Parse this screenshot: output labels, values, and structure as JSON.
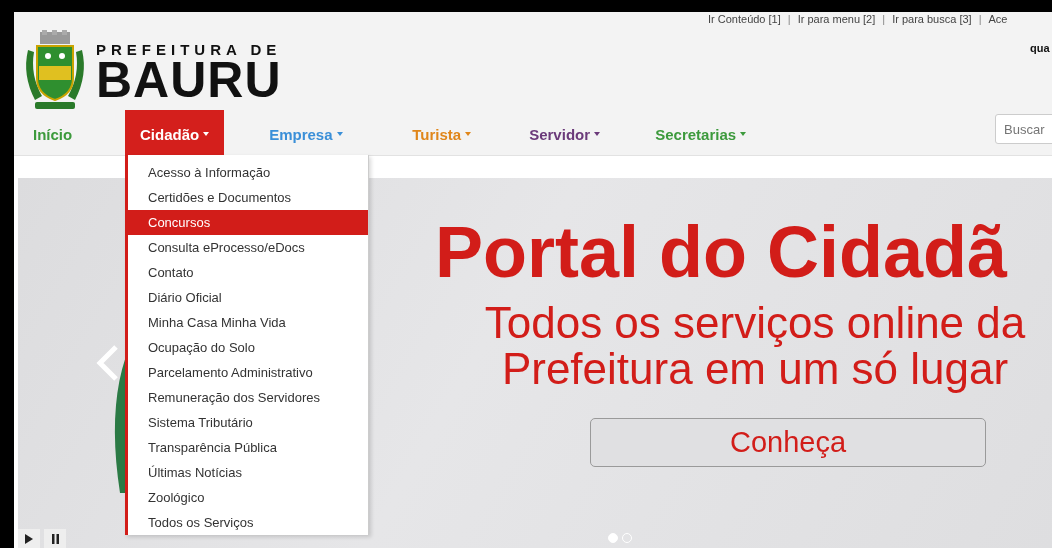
{
  "top_links": [
    {
      "kind": "link",
      "text": "Ir Conteúdo [1]"
    },
    {
      "kind": "separator",
      "text": "|"
    },
    {
      "kind": "link",
      "text": "Ir para menu [2]"
    },
    {
      "kind": "separator",
      "text": "|"
    },
    {
      "kind": "link",
      "text": "Ir para busca [3]"
    },
    {
      "kind": "separator",
      "text": "|"
    },
    {
      "kind": "link",
      "text": "Ace"
    }
  ],
  "top_right_text": "qua",
  "logo": {
    "line1": "PREFEITURA DE",
    "line2": "BAURU"
  },
  "nav": [
    {
      "label": "Início",
      "color": "#3c9a3c",
      "selected": false,
      "dropdown": false
    },
    {
      "label": "Cidadão",
      "color": "#d41f1c",
      "selected": true,
      "dropdown": true
    },
    {
      "label": "Empresa",
      "color": "#3a8fd8",
      "selected": false,
      "dropdown": true
    },
    {
      "label": "Turista",
      "color": "#e0861a",
      "selected": false,
      "dropdown": true
    },
    {
      "label": "Servidor",
      "color": "#6b3a7a",
      "selected": false,
      "dropdown": true
    },
    {
      "label": "Secretarias",
      "color": "#3c9a3c",
      "selected": false,
      "dropdown": true
    }
  ],
  "search": {
    "placeholder": "Buscar"
  },
  "dropdown_items": [
    {
      "label": "Acesso à Informação",
      "selected": false
    },
    {
      "label": "Certidões e Documentos",
      "selected": false
    },
    {
      "label": "Concursos",
      "selected": true
    },
    {
      "label": "Consulta eProcesso/eDocs",
      "selected": false
    },
    {
      "label": "Contato",
      "selected": false
    },
    {
      "label": "Diário Oficial",
      "selected": false
    },
    {
      "label": "Minha Casa Minha Vida",
      "selected": false
    },
    {
      "label": "Ocupação do Solo",
      "selected": false
    },
    {
      "label": "Parcelamento Administrativo",
      "selected": false
    },
    {
      "label": "Remuneração dos Servidores",
      "selected": false
    },
    {
      "label": "Sistema Tributário",
      "selected": false
    },
    {
      "label": "Transparência Pública",
      "selected": false
    },
    {
      "label": "Últimas Notícias",
      "selected": false
    },
    {
      "label": "Zoológico",
      "selected": false
    },
    {
      "label": "Todos os Serviços",
      "selected": false
    }
  ],
  "slide": {
    "title": "Portal do Cidadã",
    "subtitle_lines": [
      "Todos os serviços online da",
      "Prefeitura em um só lugar"
    ],
    "button": "Conheça"
  },
  "slide_dots": [
    {
      "selected": true
    },
    {
      "selected": false
    }
  ]
}
